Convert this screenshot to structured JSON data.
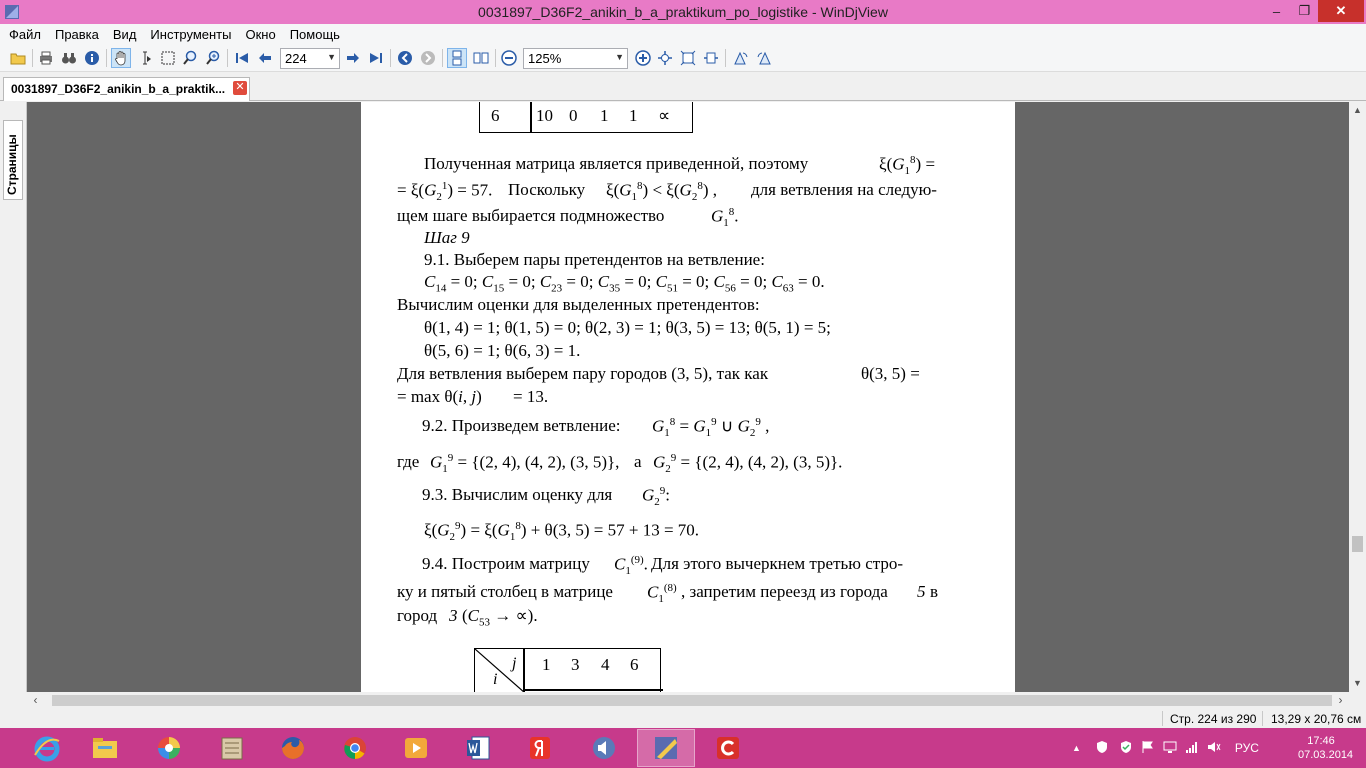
{
  "window": {
    "title": "0031897_D36F2_anikin_b_a_praktikum_po_logistike - WinDjView",
    "minimize": "–",
    "restore": "❐",
    "close": "✕"
  },
  "menu": [
    "Файл",
    "Правка",
    "Вид",
    "Инструменты",
    "Окно",
    "Помощь"
  ],
  "toolbar": {
    "page_value": "224",
    "zoom_value": "125%"
  },
  "tab": {
    "label": "0031897_D36F2_anikin_b_a_praktik...",
    "close": "✕"
  },
  "side_panel": {
    "tab_label": "Страницы"
  },
  "document": {
    "table_top_row": [
      "6",
      "10",
      "0",
      "1",
      "1",
      "∝"
    ],
    "lines": {
      "l1a": "Полученная матрица является приведенной, поэтому",
      "l2b": "Поскольку",
      "l2c": "для ветвления на следую-",
      "l3a": "щем шаге выбирается подмножество",
      "step9": "Шаг 9",
      "p91": "9.1. Выберем пары претендентов на ветвление:",
      "compute": "Вычислим оценки для выделенных претендентов:",
      "theta1": "θ(1, 4) = 1; θ(1, 5) = 0; θ(2, 3) = 1; θ(3, 5) = 13; θ(5, 1) = 5;",
      "theta2": "θ(5, 6) = 1; θ(6, 3) = 1.",
      "branch1": "Для ветвления выберем пару городов (3, 5), так как",
      "branch2": "= 13.",
      "p92": "9.2. Произведем ветвление:",
      "where": "где",
      "and": "а",
      "p93": "9.3. Вычислим оценку для",
      "p94a": "9.4. Построим матрицу",
      "p94b": "Для этого вычеркнем третью стро-",
      "p94c": "ку и пятый столбец в матрице",
      "p94d": ", запретим переезд из города",
      "city5": "5",
      "p94e": "в",
      "p94f": "город",
      "city3": "3"
    },
    "table_bottom": {
      "corner_j": "j",
      "corner_i": "i",
      "headers": [
        "1",
        "3",
        "4",
        "6"
      ]
    }
  },
  "statusbar": {
    "page_info": "Стр. 224 из 290",
    "size_info": "13,29 x 20,76 см"
  },
  "taskbar": {
    "lang": "РУС",
    "time": "17:46",
    "date": "07.03.2014"
  }
}
